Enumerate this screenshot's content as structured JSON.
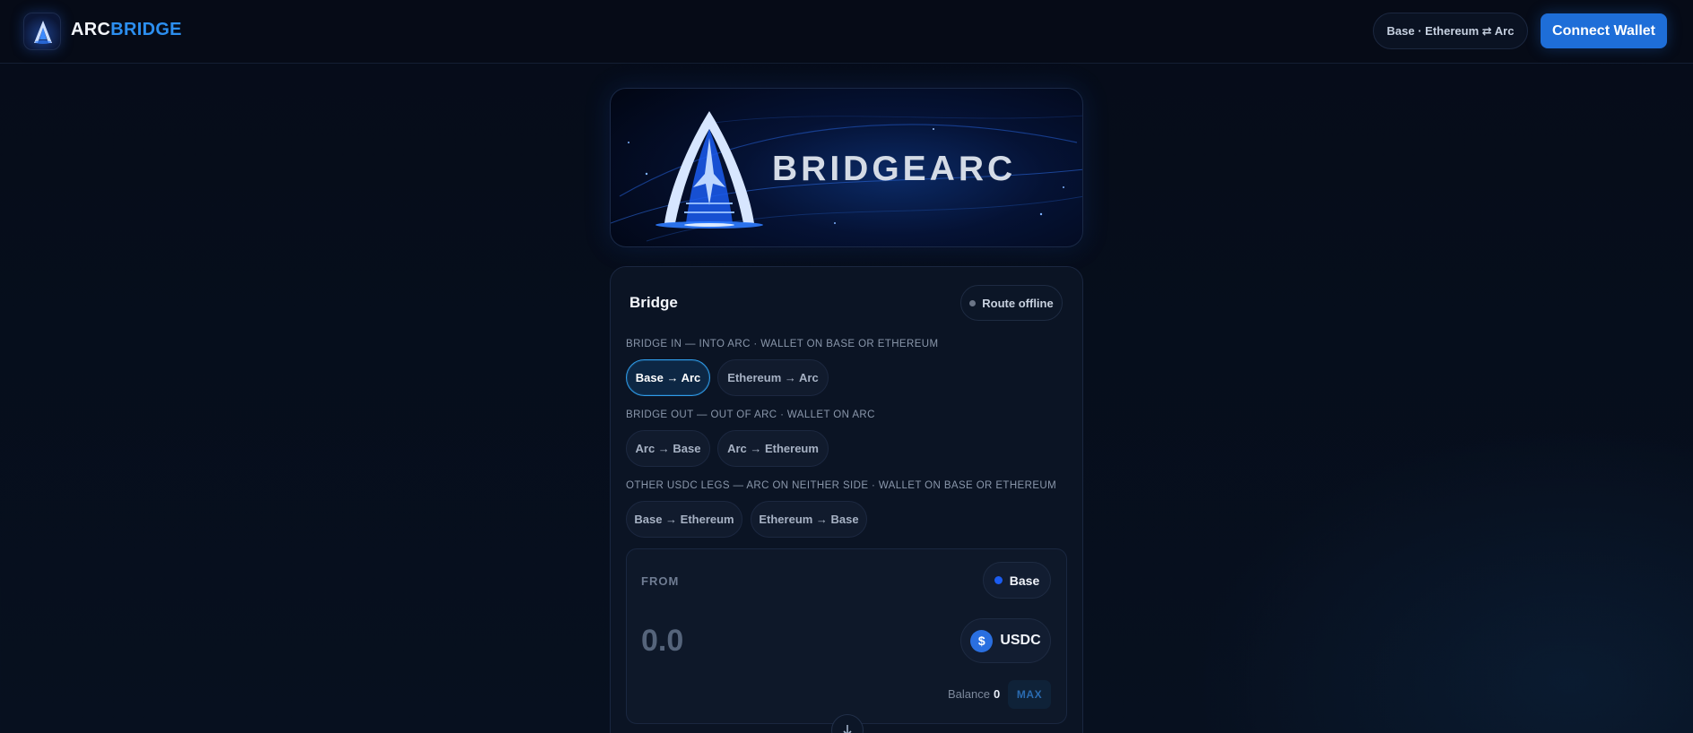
{
  "header": {
    "brand_part1": "ARC",
    "brand_part2": "BRIDGE",
    "route": "Base · Ethereum ⇄ Arc",
    "connect_label": "Connect Wallet"
  },
  "hero": {
    "wordmark": "BRIDGEARC"
  },
  "bridge": {
    "title": "Bridge",
    "status": "Route offline",
    "sections": [
      {
        "label": "BRIDGE IN — INTO ARC · WALLET ON BASE OR ETHEREUM",
        "routes": [
          "Base → Arc",
          "Ethereum → Arc"
        ]
      },
      {
        "label": "BRIDGE OUT — OUT OF ARC · WALLET ON ARC",
        "routes": [
          "Arc → Base",
          "Arc → Ethereum"
        ]
      },
      {
        "label": "OTHER USDC LEGS — ARC ON NEITHER SIDE · WALLET ON BASE OR ETHEREUM",
        "routes": [
          "Base → Ethereum",
          "Ethereum → Base"
        ]
      }
    ],
    "selected_route": "Base → Arc",
    "from": {
      "label": "FROM",
      "network": "Base",
      "amount_placeholder": "0.0",
      "token": "USDC",
      "token_symbol": "$",
      "balance_label": "Balance",
      "balance_value": "0",
      "max_label": "MAX"
    }
  },
  "colors": {
    "accent": "#1e6ed8",
    "brand_blue": "#2c8ff0",
    "background": "#060c19",
    "network_base": "#1b5cf0"
  }
}
